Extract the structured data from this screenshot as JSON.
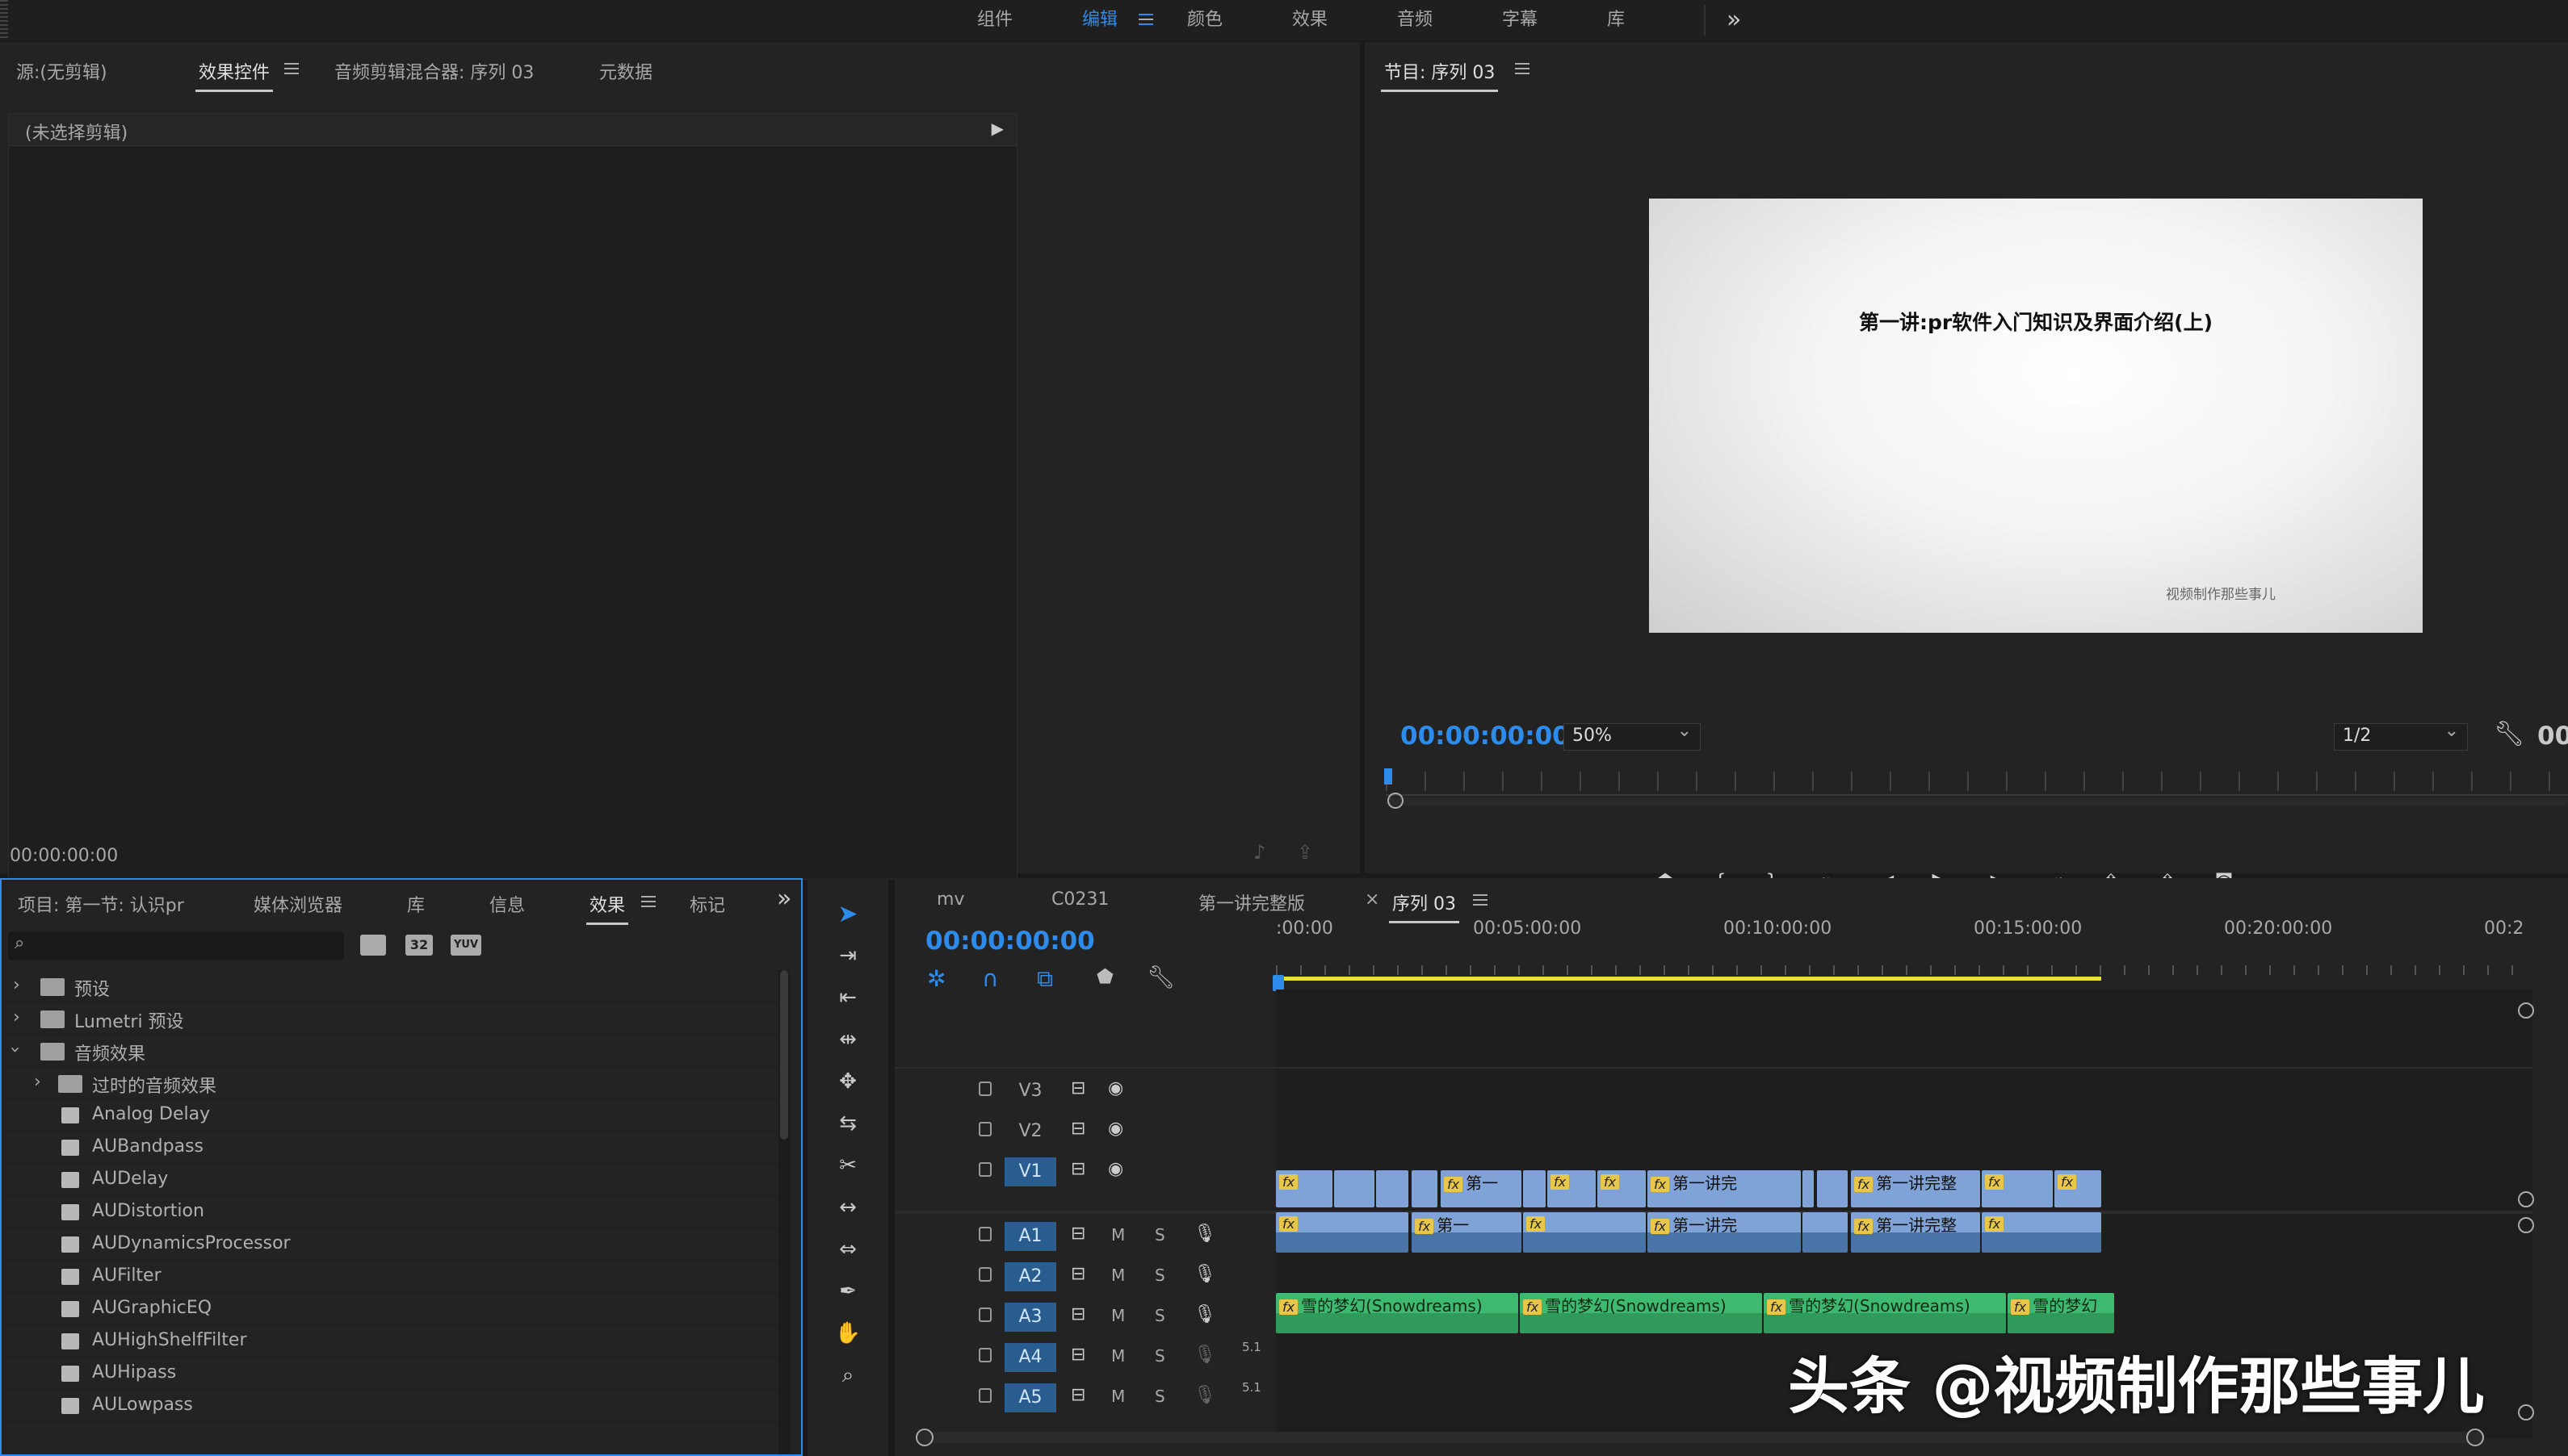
{
  "workspaces": {
    "items": [
      "组件",
      "编辑",
      "颜色",
      "效果",
      "音频",
      "字幕",
      "库"
    ],
    "active": "编辑",
    "overflow_icon": "double-chevron-right-icon"
  },
  "source_panel": {
    "tabs": [
      "源:(无剪辑)",
      "效果控件",
      "音频剪辑混合器: 序列 03",
      "元数据"
    ],
    "active_tab": "效果控件",
    "no_clip_text": "(未选择剪辑)",
    "timecode": "00:00:00:00"
  },
  "program_monitor": {
    "title": "节目: 序列 03",
    "video_title": "第一讲:pr软件入门知识及界面介绍(上)",
    "watermark": "视频制作那些事儿",
    "timecode": "00:00:00:00",
    "zoom": "50%",
    "resolution": "1/2",
    "right_timecode_partial": "00"
  },
  "project_panel": {
    "tabs": [
      "项目: 第一节: 认识pr",
      "媒体浏览器",
      "库",
      "信息",
      "效果",
      "标记"
    ],
    "active_tab": "效果",
    "search_placeholder": "",
    "filter_badges": [
      "32",
      "YUV"
    ],
    "items": [
      {
        "label": "预设",
        "type": "folder",
        "indent": 0,
        "expanded": false
      },
      {
        "label": "Lumetri 预设",
        "type": "folder",
        "indent": 0,
        "expanded": false
      },
      {
        "label": "音频效果",
        "type": "folder",
        "indent": 0,
        "expanded": true
      },
      {
        "label": "过时的音频效果",
        "type": "folder",
        "indent": 1,
        "expanded": false
      },
      {
        "label": "Analog Delay",
        "type": "effect",
        "indent": 1
      },
      {
        "label": "AUBandpass",
        "type": "effect",
        "indent": 1
      },
      {
        "label": "AUDelay",
        "type": "effect",
        "indent": 1
      },
      {
        "label": "AUDistortion",
        "type": "effect",
        "indent": 1
      },
      {
        "label": "AUDynamicsProcessor",
        "type": "effect",
        "indent": 1
      },
      {
        "label": "AUFilter",
        "type": "effect",
        "indent": 1
      },
      {
        "label": "AUGraphicEQ",
        "type": "effect",
        "indent": 1
      },
      {
        "label": "AUHighShelfFilter",
        "type": "effect",
        "indent": 1
      },
      {
        "label": "AUHipass",
        "type": "effect",
        "indent": 1
      },
      {
        "label": "AULowpass",
        "type": "effect",
        "indent": 1
      }
    ]
  },
  "timeline": {
    "tabs": [
      "mv",
      "C0231",
      "第一讲完整版",
      "序列 03"
    ],
    "active_tab": "序列 03",
    "close_icon": "×",
    "timecode": "00:00:00:00",
    "ruler_labels": [
      ":00:00",
      "00:05:00:00",
      "00:10:00:00",
      "00:15:00:00",
      "00:20:00:00",
      "00:2"
    ],
    "tracks": [
      {
        "name": "V3",
        "kind": "video",
        "targeted": false
      },
      {
        "name": "V2",
        "kind": "video",
        "targeted": false
      },
      {
        "name": "V1",
        "kind": "video",
        "targeted": true
      },
      {
        "name": "A1",
        "kind": "audio",
        "targeted": true,
        "m": "M",
        "s": "S"
      },
      {
        "name": "A2",
        "kind": "audio",
        "targeted": true,
        "m": "M",
        "s": "S"
      },
      {
        "name": "A3",
        "kind": "audio",
        "targeted": true,
        "m": "M",
        "s": "S"
      },
      {
        "name": "A4",
        "kind": "audio",
        "targeted": true,
        "m": "M",
        "s": "S",
        "channel": "5.1"
      },
      {
        "name": "A5",
        "kind": "audio",
        "targeted": true,
        "m": "M",
        "s": "S",
        "channel": "5.1"
      }
    ],
    "v1_clip_titles": [
      "第一",
      "第一讲完",
      "第一讲完整"
    ],
    "a1_clip_titles": [
      "第一",
      "第一讲完",
      "第一讲完整"
    ],
    "a3_clip_titles": [
      "雪的梦幻(Snowdreams)",
      "雪的梦幻(Snowdreams)",
      "雪的梦幻(Snowdreams)",
      "雪的梦幻"
    ],
    "fx_badge": "fx"
  },
  "overlay_watermark": "头条 @视频制作那些事儿",
  "colors": {
    "accent": "#2d8ceb",
    "panel_bg": "#232323",
    "video_clip": "#7fa3d6",
    "audio_clip": "#5a8cc4",
    "music_clip": "#3fb970",
    "work_area": "#e8e13a"
  }
}
